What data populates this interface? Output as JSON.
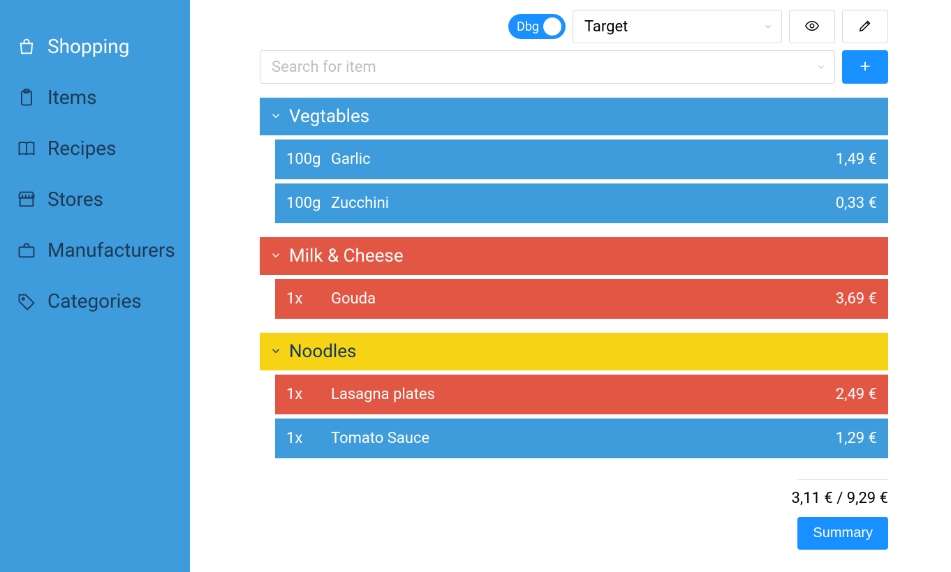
{
  "sidebar": {
    "items": [
      {
        "label": "Shopping"
      },
      {
        "label": "Items"
      },
      {
        "label": "Recipes"
      },
      {
        "label": "Stores"
      },
      {
        "label": "Manufacturers"
      },
      {
        "label": "Categories"
      }
    ]
  },
  "toolbar": {
    "debug_label": "Dbg",
    "store_selected": "Target"
  },
  "search": {
    "placeholder": "Search for item"
  },
  "groups": [
    {
      "title": "Vegtables",
      "header_color": "blue",
      "items": [
        {
          "qty": "100g",
          "name": "Garlic",
          "price": "1,49 €",
          "row_color": "blue"
        },
        {
          "qty": "100g",
          "name": "Zucchini",
          "price": "0,33 €",
          "row_color": "blue"
        }
      ]
    },
    {
      "title": "Milk & Cheese",
      "header_color": "red",
      "items": [
        {
          "qty": "1x",
          "name": "Gouda",
          "price": "3,69 €",
          "row_color": "red"
        }
      ]
    },
    {
      "title": "Noodles",
      "header_color": "yellow",
      "items": [
        {
          "qty": "1x",
          "name": "Lasagna plates",
          "price": "2,49 €",
          "row_color": "red"
        },
        {
          "qty": "1x",
          "name": "Tomato Sauce",
          "price": "1,29 €",
          "row_color": "blue"
        }
      ]
    }
  ],
  "footer": {
    "total": "3,11 € / 9,29 €",
    "summary_label": "Summary"
  }
}
